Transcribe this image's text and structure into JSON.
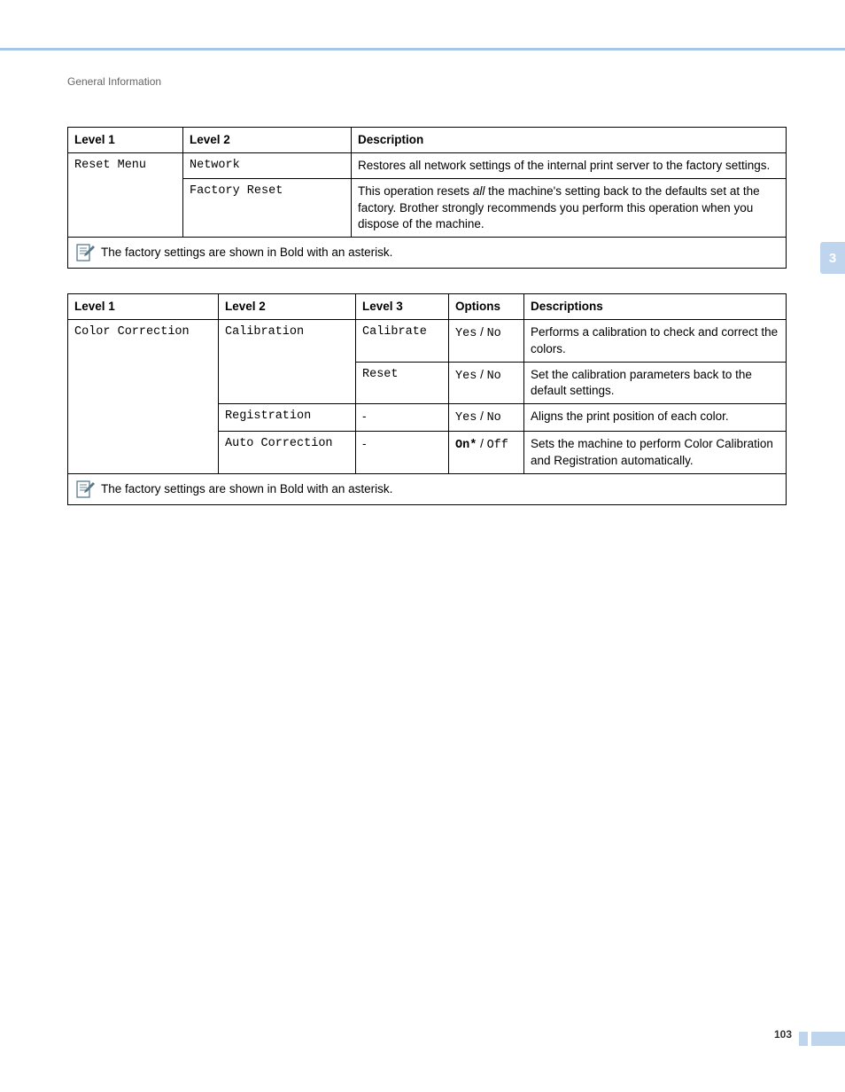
{
  "header": {
    "section": "General Information"
  },
  "side_tab": "3",
  "table1": {
    "headers": {
      "c1": "Level 1",
      "c2": "Level 2",
      "c3": "Description"
    },
    "rows": [
      {
        "level1": "Reset Menu",
        "level2": "Network",
        "desc": "Restores all network settings of the internal print server to the factory settings."
      },
      {
        "level2": "Factory Reset",
        "desc_pre": "This operation resets ",
        "desc_italic": "all",
        "desc_post": " the machine's setting back to the defaults set at the factory. Brother strongly recommends you perform this operation when you dispose of the machine."
      }
    ],
    "note": "The factory settings are shown in Bold with an asterisk."
  },
  "table2": {
    "headers": {
      "c1": "Level 1",
      "c2": "Level 2",
      "c3": "Level 3",
      "c4": "Options",
      "c5": "Descriptions"
    },
    "rows": [
      {
        "level1": "Color Correction",
        "level2": "Calibration",
        "level3": "Calibrate",
        "opt_a": "Yes",
        "opt_sep": " / ",
        "opt_b": "No",
        "desc": "Performs a calibration to check and correct the colors."
      },
      {
        "level3": "Reset",
        "opt_a": "Yes",
        "opt_sep": " / ",
        "opt_b": "No",
        "desc": "Set the calibration parameters back to the default settings."
      },
      {
        "level2": "Registration",
        "level3": "-",
        "opt_a": "Yes",
        "opt_sep": " / ",
        "opt_b": "No",
        "desc": "Aligns the print position of each color."
      },
      {
        "level2": "Auto Correction",
        "level3": "-",
        "opt_bold": "On*",
        "opt_sep": " / ",
        "opt_b": "Off",
        "desc": "Sets the machine to perform Color Calibration and Registration automatically."
      }
    ],
    "note": "The factory settings are shown in Bold with an asterisk."
  },
  "footer": {
    "page": "103"
  }
}
